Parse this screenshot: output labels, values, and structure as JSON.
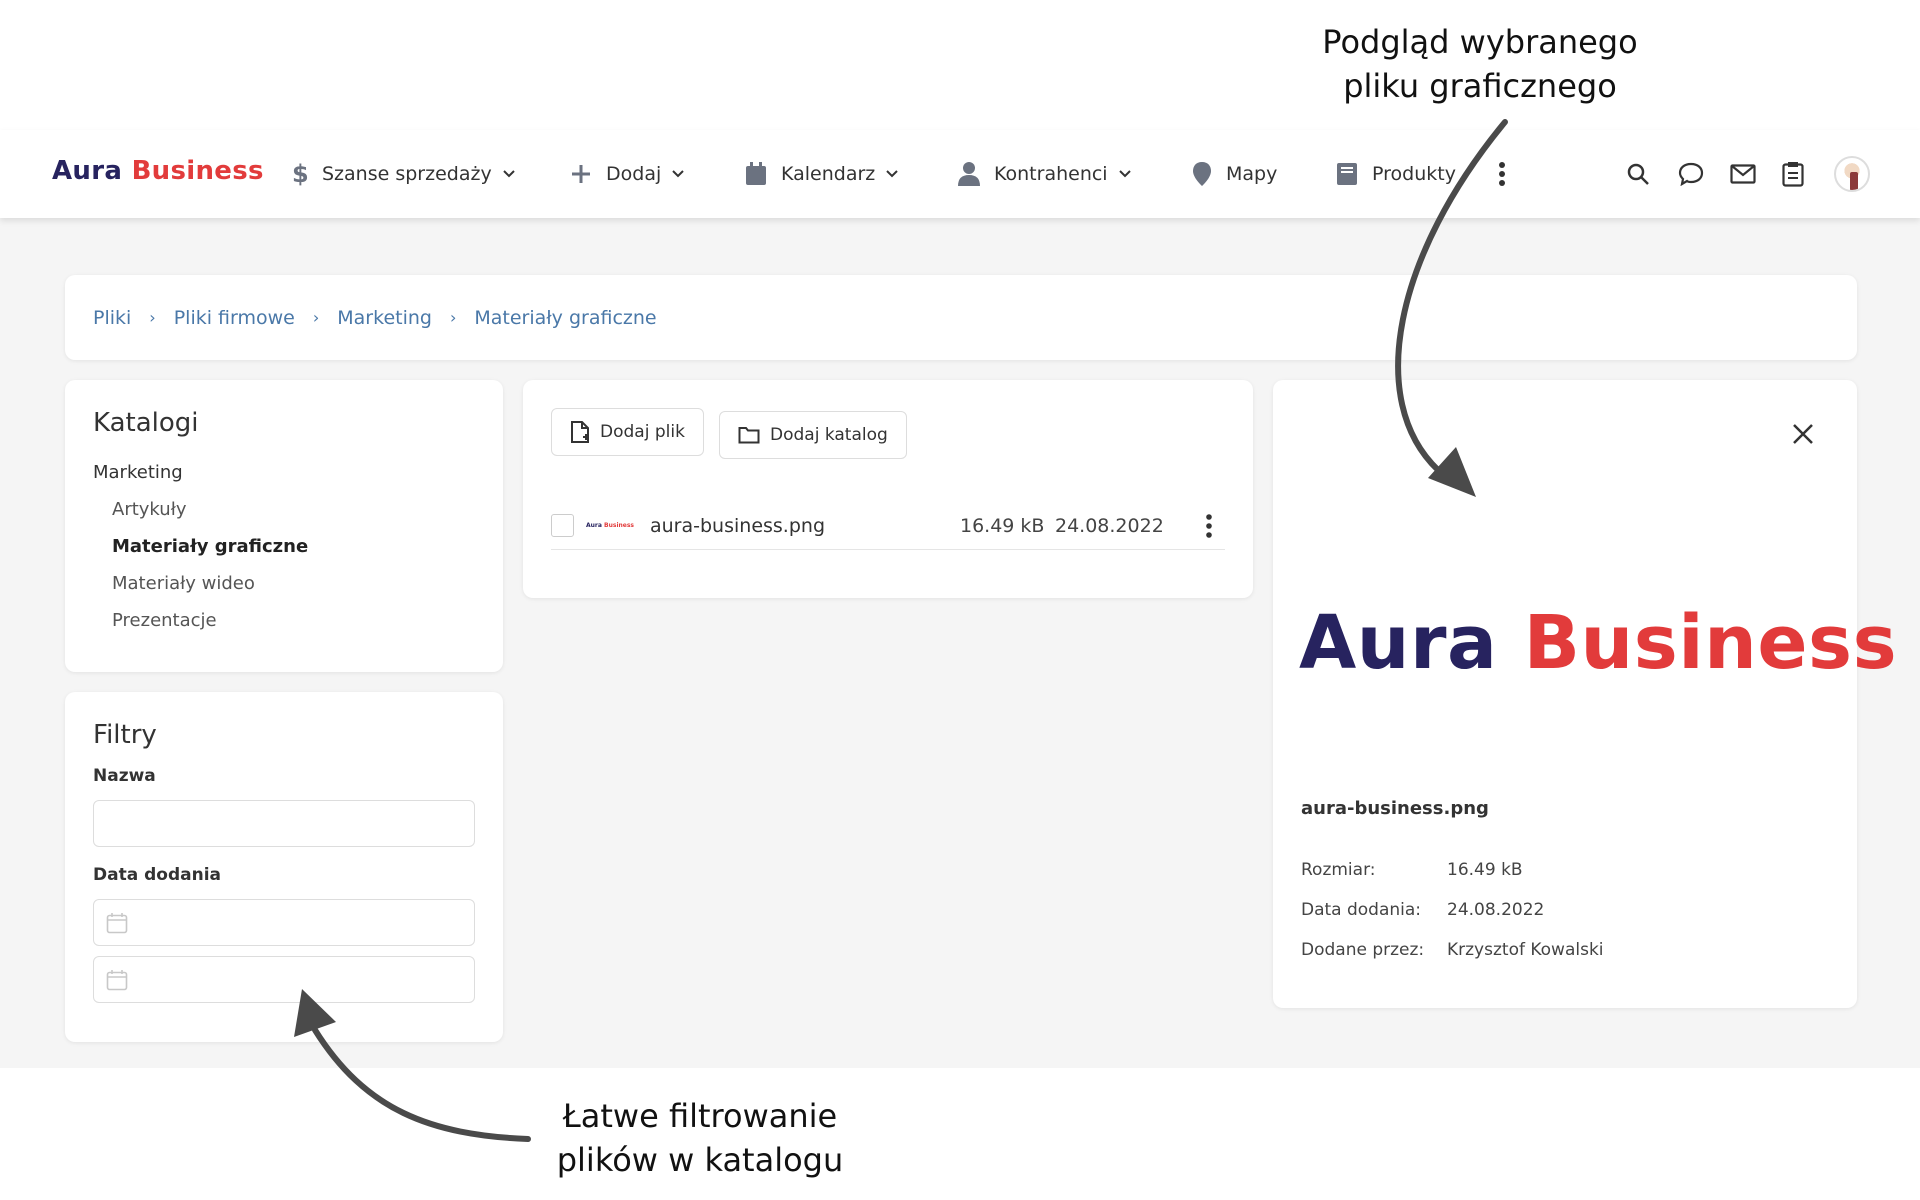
{
  "annotations": {
    "top_line1": "Podgląd wybranego",
    "top_line2": "pliku graficznego",
    "bottom_line1": "Łatwe filtrowanie",
    "bottom_line2": "plików w katalogu"
  },
  "brand": {
    "part1": "Aura",
    "part2": "Business",
    "color_dark": "#27235f",
    "color_red": "#e23b3b"
  },
  "nav": {
    "items": [
      {
        "label": "Szanse sprzedaży",
        "icon": "dollar-icon",
        "dropdown": true
      },
      {
        "label": "Dodaj",
        "icon": "plus-icon",
        "dropdown": true
      },
      {
        "label": "Kalendarz",
        "icon": "calendar-icon",
        "dropdown": true
      },
      {
        "label": "Kontrahenci",
        "icon": "person-icon",
        "dropdown": true
      },
      {
        "label": "Mapy",
        "icon": "map-pin-icon",
        "dropdown": false
      },
      {
        "label": "Produkty",
        "icon": "book-icon",
        "dropdown": false
      }
    ],
    "right_icons": [
      "search-icon",
      "chat-icon",
      "mail-icon",
      "clipboard-icon",
      "avatar"
    ]
  },
  "breadcrumb": [
    "Pliki",
    "Pliki firmowe",
    "Marketing",
    "Materiały graficzne"
  ],
  "catalogs": {
    "title": "Katalogi",
    "root": "Marketing",
    "children": [
      "Artykuły",
      "Materiały graficzne",
      "Materiały wideo",
      "Prezentacje"
    ],
    "active": "Materiały graficzne"
  },
  "filters": {
    "title": "Filtry",
    "name_label": "Nazwa",
    "date_label": "Data dodania"
  },
  "files": {
    "add_file": "Dodaj plik",
    "add_folder": "Dodaj katalog",
    "rows": [
      {
        "name": "aura-business.png",
        "size": "16.49 kB",
        "date": "24.08.2022"
      }
    ]
  },
  "preview": {
    "filename": "aura-business.png",
    "size_label": "Rozmiar:",
    "size_value": "16.49 kB",
    "date_label": "Data dodania:",
    "date_value": "24.08.2022",
    "by_label": "Dodane przez:",
    "by_value": "Krzysztof Kowalski"
  }
}
